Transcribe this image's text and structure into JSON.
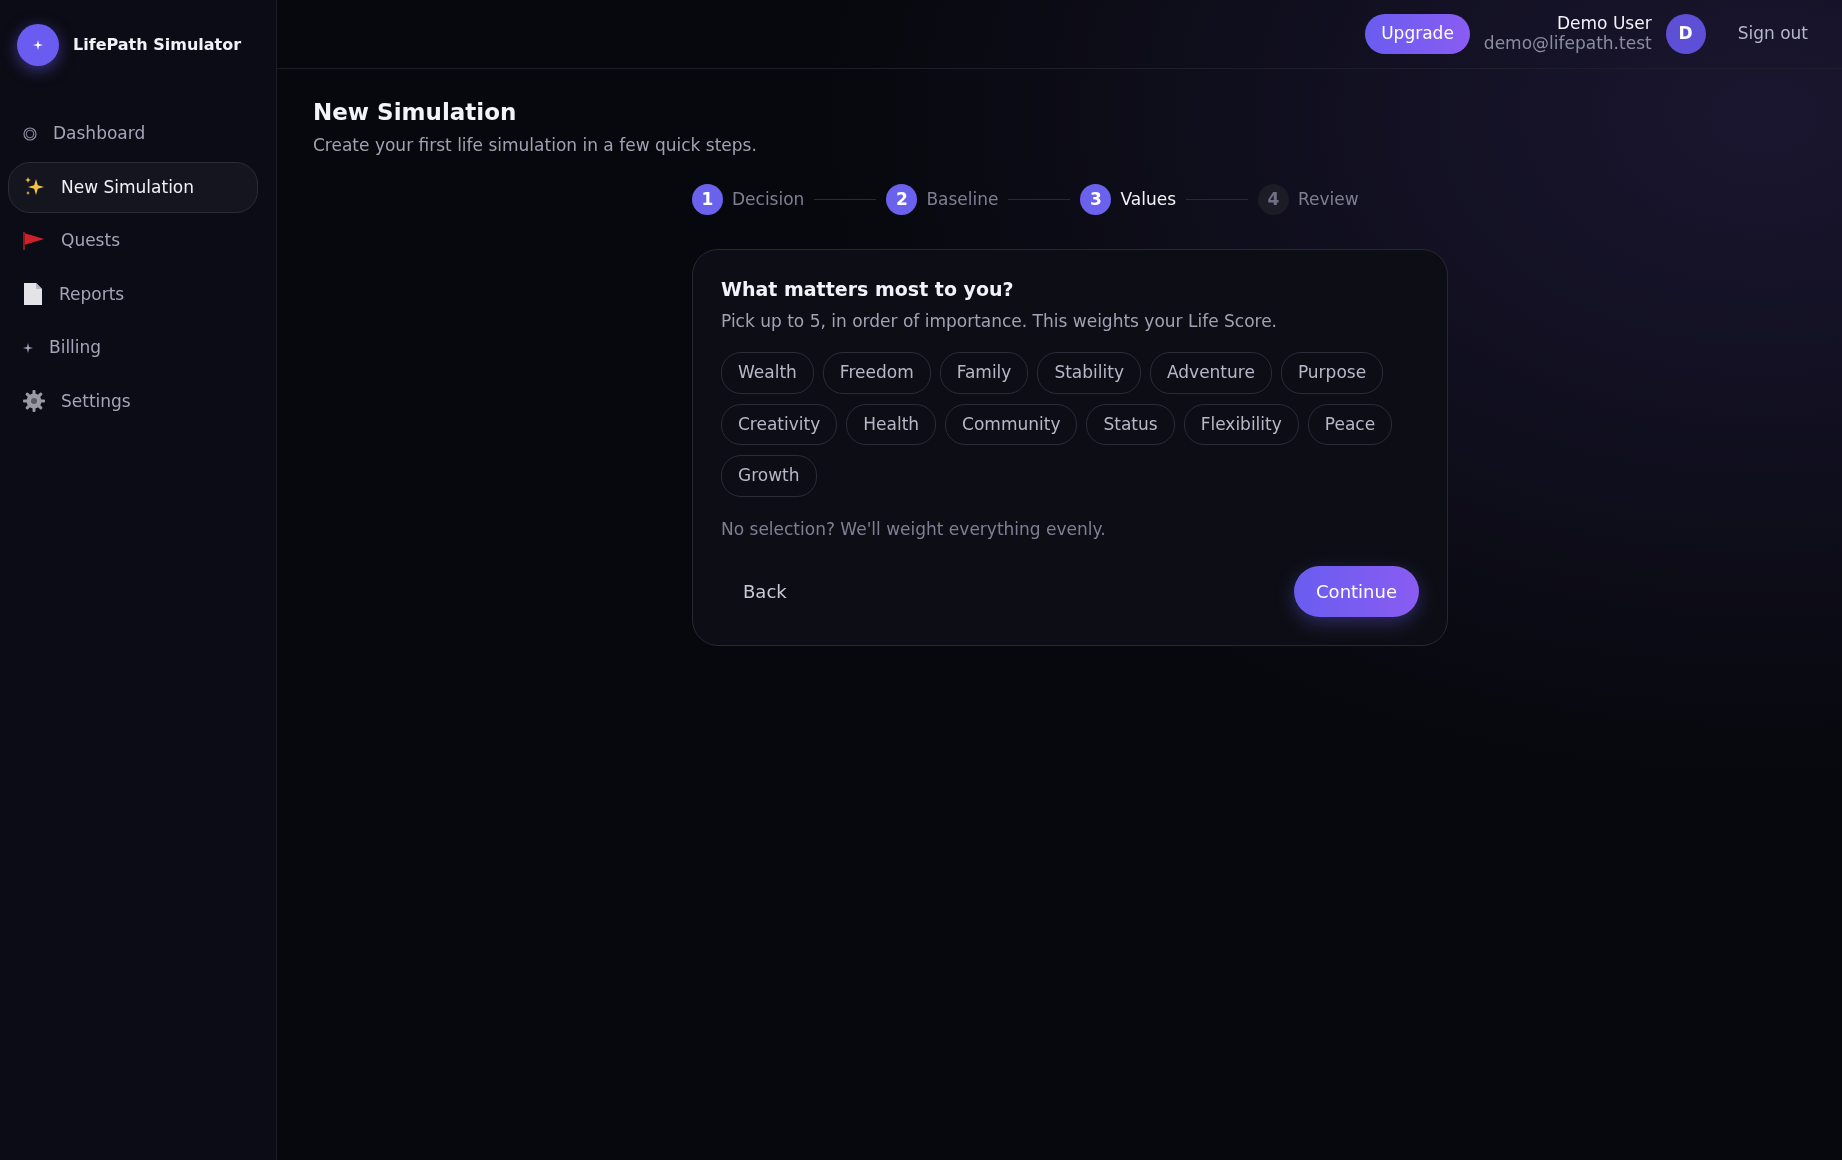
{
  "app": {
    "title": "LifePath Simulator"
  },
  "sidebar": {
    "items": [
      {
        "label": "Dashboard",
        "selected": false
      },
      {
        "label": "New Simulation",
        "selected": true
      },
      {
        "label": "Quests",
        "selected": false
      },
      {
        "label": "Reports",
        "selected": false
      },
      {
        "label": "Billing",
        "selected": false
      },
      {
        "label": "Settings",
        "selected": false
      }
    ]
  },
  "header": {
    "upgrade_button": "Upgrade",
    "user": {
      "name": "Demo User",
      "email": "demo@lifepath.test",
      "avatar": "D"
    },
    "sign_out": "Sign out"
  },
  "page": {
    "title": "New Simulation",
    "subtitle": "Create your first life simulation in a few quick steps."
  },
  "stepper": [
    {
      "number": "1",
      "label": "Decision",
      "reached": true,
      "selected": false
    },
    {
      "number": "2",
      "label": "Baseline",
      "reached": true,
      "selected": false
    },
    {
      "number": "3",
      "label": "Values",
      "reached": true,
      "selected": true
    },
    {
      "number": "4",
      "label": "Review",
      "reached": false,
      "selected": false
    }
  ],
  "card": {
    "heading": "What matters most to you?",
    "description": "Pick up to 5, in order of importance. This weights your Life Score.",
    "values": [
      {
        "label": "Wealth",
        "selected": false
      },
      {
        "label": "Freedom",
        "selected": false
      },
      {
        "label": "Family",
        "selected": false
      },
      {
        "label": "Stability",
        "selected": false
      },
      {
        "label": "Adventure",
        "selected": false
      },
      {
        "label": "Purpose",
        "selected": false
      },
      {
        "label": "Creativity",
        "selected": false
      },
      {
        "label": "Health",
        "selected": false
      },
      {
        "label": "Community",
        "selected": false
      },
      {
        "label": "Status",
        "selected": false
      },
      {
        "label": "Flexibility",
        "selected": false
      },
      {
        "label": "Peace",
        "selected": false
      },
      {
        "label": "Growth",
        "selected": false
      }
    ],
    "hint": "No selection? We'll weight everything evenly.",
    "back_button": "Back",
    "continue_button": "Continue"
  }
}
